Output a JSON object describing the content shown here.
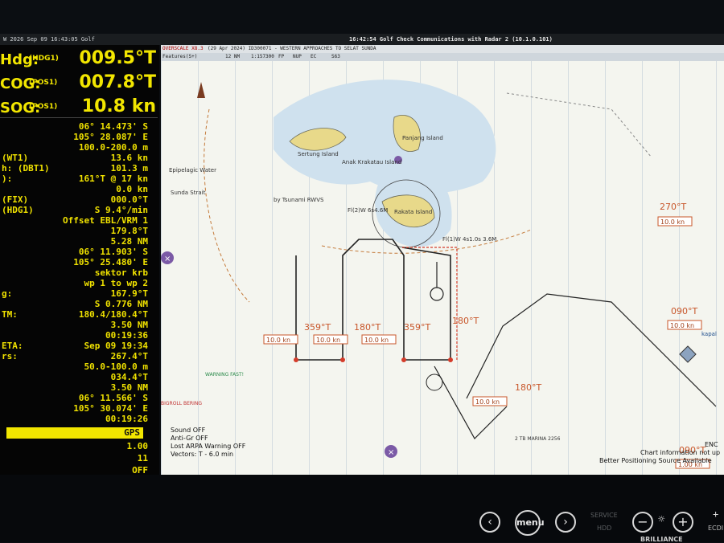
{
  "topbar": {
    "left": "W     2026 Sep 09     16:43:05 Golf",
    "right": "16:42:54 Golf   Check Communications with Radar 2 (10.1.0.101)"
  },
  "header": {
    "overscale": "OVERSCALE X8.3",
    "title": "(29 Apr 2024) ID300071 - WESTERN APPROACHES TO SELAT SUNDA",
    "features": "Features(S+)",
    "range": "12 NM",
    "scale": "1:157300",
    "fp": "FP",
    "nup": "NUP",
    "ec": "EC",
    "s63": "S63"
  },
  "nav": {
    "hdg": {
      "label": "Hdg:",
      "src": "(HDG1)",
      "value": "009.5°T"
    },
    "cog": {
      "label": "COG:",
      "src": "(POS1)",
      "value": "007.8°T"
    },
    "sog": {
      "label": "SOG:",
      "src": "(POS1)",
      "value": "10.8 kn"
    }
  },
  "rows": [
    {
      "k": "",
      "v": "06° 14.473' S"
    },
    {
      "k": "",
      "v": "105° 28.087' E"
    },
    {
      "k": "",
      "v": "100.0-200.0 m"
    },
    {
      "k": "(WT1)",
      "v": "13.6 kn"
    },
    {
      "k": "h: (DBT1)",
      "v": "101.3 m"
    },
    {
      "k": "):",
      "v": "161°T @ 17 kn"
    },
    {
      "k": "",
      "v": "0.0 kn"
    },
    {
      "k": "(FIX)",
      "v": "000.0°T"
    },
    {
      "k": "(HDG1)",
      "v": "S  9.4°/min"
    },
    {
      "k": "",
      "v": "Offset EBL/VRM 1"
    },
    {
      "k": "",
      "v": "179.8°T"
    },
    {
      "k": "",
      "v": "5.28 NM"
    },
    {
      "k": "",
      "v": "06° 11.903' S"
    },
    {
      "k": "",
      "v": "105° 25.480' E"
    },
    {
      "k": "",
      "v": "sektor krb"
    },
    {
      "k": "",
      "v": "wp 1 to wp 2"
    },
    {
      "k": "g:",
      "v": "167.9°T"
    },
    {
      "k": "",
      "v": "S 0.776 NM"
    },
    {
      "k": "TM:",
      "v": "180.4/180.4°T"
    },
    {
      "k": "",
      "v": "3.50 NM"
    },
    {
      "k": "",
      "v": "00:19:36"
    },
    {
      "k": "ETA:",
      "v": "Sep 09 19:34"
    },
    {
      "k": "rs:",
      "v": "267.4°T"
    },
    {
      "k": "",
      "v": "50.0-100.0 m"
    },
    {
      "k": "",
      "v": "034.4°T"
    },
    {
      "k": "",
      "v": "3.50 NM"
    },
    {
      "k": "",
      "v": "06° 11.566' S"
    },
    {
      "k": "",
      "v": "105° 30.074' E"
    },
    {
      "k": "",
      "v": "00:19:26"
    }
  ],
  "gps": {
    "label": "GPS",
    "v1": "1.00",
    "v2": "11",
    "v3": "OFF"
  },
  "chart": {
    "islands": {
      "sebuku": "Sertung Island",
      "anak": "Anak Krakatau Island",
      "panjang": "Panjang Island",
      "rakata": "Rakata Island",
      "sunda": "Sunda Strait",
      "epipelagic": "Epipelagic Water"
    },
    "labels": {
      "rwvs": "by Tsunami RWVS",
      "fk1": "Fl(2)W 6s4.6M",
      "fk2": "Fl(1)W 4s1.0s 3.6M",
      "warning": "WARNING FAST!",
      "bigroll": "BIGROLL BERING",
      "marina": "2 TB MARINA 2256",
      "kapal": "kapal"
    },
    "bearings": [
      "359°T",
      "180°T",
      "359°T",
      "180°T",
      "180°T",
      "270°T",
      "090°T",
      "090°T"
    ],
    "speeds": [
      "10.0 kn",
      "10.0 kn",
      "10.0 kn",
      "10.0 kn",
      "10.0 kn",
      "10.0 kn",
      "1.00 kn"
    ],
    "status": [
      "Sound OFF",
      "Anti-Gr OFF",
      "Lost ARPA Warning OFF",
      "Vectors: T - 6.0 min"
    ],
    "info": [
      "ENC",
      "Chart information not up",
      "Better Positioning Source Available"
    ]
  },
  "bottom": {
    "service": "SERVICE",
    "hdd": "HDD",
    "menu": "menu",
    "brilliance": "BRILLIANCE",
    "ecdis": "ECDI"
  }
}
